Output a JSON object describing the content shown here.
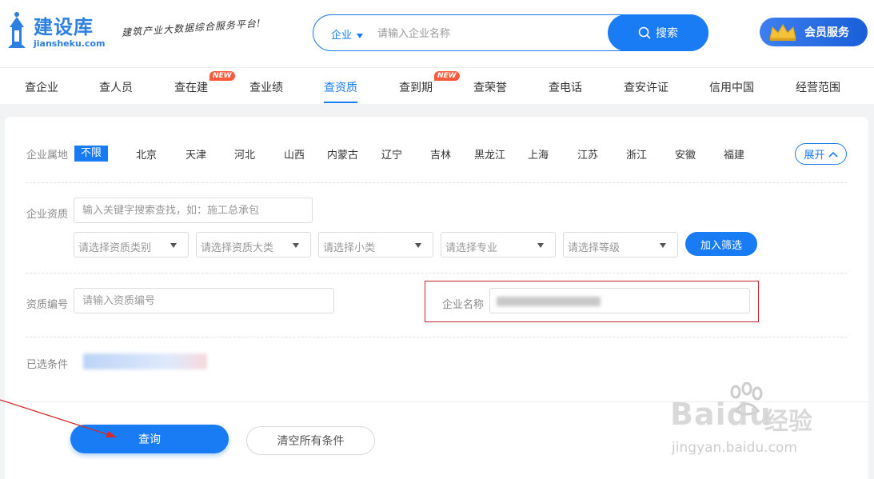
{
  "header": {
    "logo_title": "建设库",
    "logo_sub": "jiansheku.com",
    "slogan": "建筑产业大数据综合服务平台!",
    "search_type": "企业",
    "search_placeholder": "请输入企业名称",
    "search_button": "搜索",
    "member_button": "会员服务"
  },
  "nav": {
    "items": [
      {
        "label": "查企业"
      },
      {
        "label": "查人员"
      },
      {
        "label": "查在建",
        "badge": "NEW"
      },
      {
        "label": "查业绩"
      },
      {
        "label": "查资质",
        "active": true
      },
      {
        "label": "查到期",
        "badge": "NEW"
      },
      {
        "label": "查荣誉"
      },
      {
        "label": "查电话"
      },
      {
        "label": "查安许证"
      },
      {
        "label": "信用中国"
      },
      {
        "label": "经营范围"
      }
    ]
  },
  "filters": {
    "region_label": "企业属地",
    "region_all": "不限",
    "regions": [
      "北京",
      "天津",
      "河北",
      "山西",
      "内蒙古",
      "辽宁",
      "吉林",
      "黑龙江",
      "上海",
      "江苏",
      "浙江",
      "安徽",
      "福建"
    ],
    "expand_button": "展开",
    "qualification_label": "企业资质",
    "qualification_placeholder": "输入关键字搜索查找，如：施工总承包",
    "selects": [
      "请选择资质类别",
      "请选择资质大类",
      "请选择小类",
      "请选择专业",
      "请选择等级"
    ],
    "add_filter_button": "加入筛选",
    "cert_no_label": "资质编号",
    "cert_no_placeholder": "请输入资质编号",
    "company_name_label": "企业名称",
    "selected_label": "已选条件"
  },
  "actions": {
    "query_button": "查询",
    "clear_button": "清空所有条件"
  },
  "watermark": {
    "logo": "Bai",
    "logo_suffix": "du",
    "cn": "经验",
    "url": "jingyan.baidu.com"
  },
  "colors": {
    "primary": "#1a7cf5",
    "badge": "#ff5a3c",
    "highlight_box": "#c6242a"
  }
}
